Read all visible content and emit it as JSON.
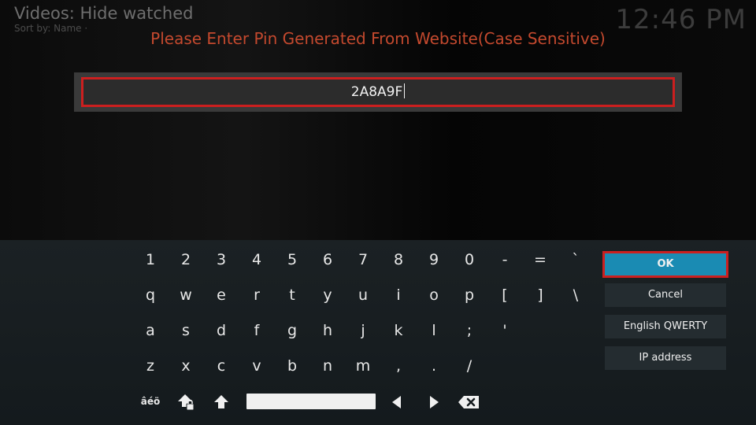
{
  "header": {
    "title": "Videos: Hide watched",
    "sort_label": "Sort by: Name  ·",
    "clock": "12:46 PM"
  },
  "dialog": {
    "heading": "Please Enter Pin Generated From Website(Case Sensitive)",
    "input_value": "2A8A9F"
  },
  "colors": {
    "heading": "#c4492e",
    "focus_border": "#cc1f1f",
    "ok_button": "#1a8bb3"
  },
  "keyboard": {
    "rows": [
      [
        "1",
        "2",
        "3",
        "4",
        "5",
        "6",
        "7",
        "8",
        "9",
        "0",
        "-",
        "=",
        "`"
      ],
      [
        "q",
        "w",
        "e",
        "r",
        "t",
        "y",
        "u",
        "i",
        "o",
        "p",
        "[",
        "]",
        "\\"
      ],
      [
        "a",
        "s",
        "d",
        "f",
        "g",
        "h",
        "j",
        "k",
        "l",
        ";",
        "'"
      ],
      [
        "z",
        "x",
        "c",
        "v",
        "b",
        "n",
        "m",
        ",",
        ".",
        "/"
      ]
    ],
    "accents_key": "âéö",
    "icons": [
      "caps-lock-icon",
      "shift-icon",
      "space-bar",
      "arrow-left-icon",
      "arrow-right-icon",
      "backspace-icon"
    ]
  },
  "buttons": {
    "ok": "OK",
    "cancel": "Cancel",
    "layout": "English QWERTY",
    "ip": "IP address"
  }
}
